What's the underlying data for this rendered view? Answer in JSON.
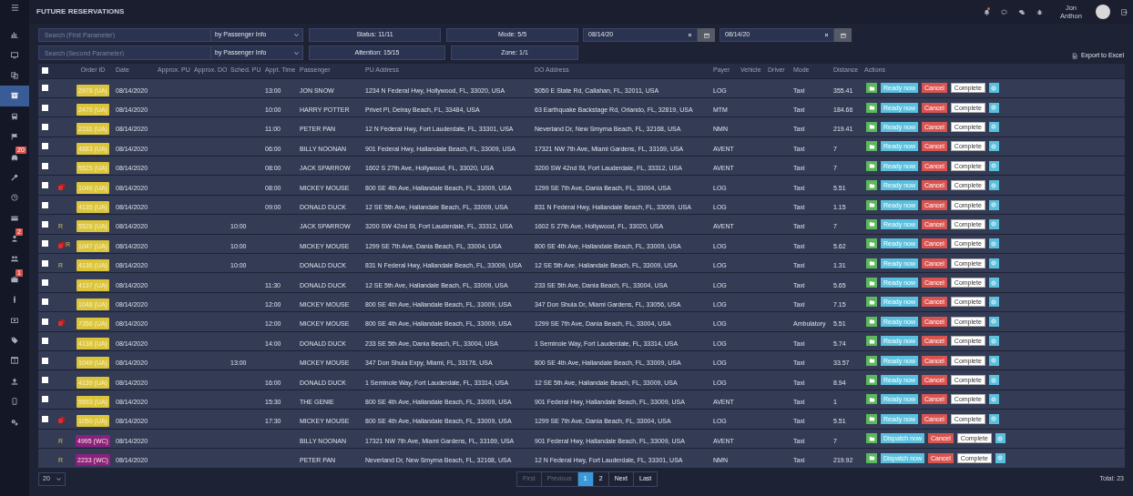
{
  "page_title": "FUTURE RESERVATIONS",
  "sidebar": {
    "items": [
      {
        "selected": false
      },
      {
        "selected": false
      },
      {
        "selected": false
      },
      {
        "selected": true
      },
      {
        "selected": false
      },
      {
        "selected": false
      },
      {
        "selected": false,
        "badge": "20"
      },
      {
        "selected": false
      },
      {
        "selected": false
      },
      {
        "selected": false
      },
      {
        "selected": false,
        "badge": "2"
      },
      {
        "selected": false
      },
      {
        "selected": false,
        "badge": "1"
      },
      {
        "selected": false
      },
      {
        "selected": false
      },
      {
        "selected": false
      },
      {
        "selected": false
      },
      {
        "selected": false
      },
      {
        "selected": false
      },
      {
        "selected": false
      }
    ]
  },
  "header": {
    "notification_dot": true,
    "user_name": "Jon Anthon"
  },
  "filters": {
    "search_1": {
      "placeholder": "Search (First Parameter)",
      "by": "by Passenger Info"
    },
    "search_2": {
      "placeholder": "Search (Second Parameter)",
      "by": "by Passenger Info"
    },
    "status": "Status: 11/11",
    "mode": "Mode: 5/5",
    "attention": "Attention: 15/15",
    "zone": "Zone: 1/1",
    "date_from": "08/14/20",
    "date_to": "08/14/20"
  },
  "export": "Export to Excel",
  "table": {
    "select_all": {
      "checked": false
    },
    "columns": [
      "Order ID",
      "Date",
      "Approx. PU",
      "Approx. DO",
      "Sched. PU",
      "Appt. Time",
      "Passenger",
      "PU Address",
      "DO Address",
      "Payer",
      "Vehicle",
      "Driver",
      "Mode",
      "Distance",
      "Actions"
    ],
    "rows": [
      {
        "checked": false,
        "flagged": false,
        "order": {
          "text": "2978 (UA)",
          "color": "#dcc53a"
        },
        "date": "08/14/2020",
        "sched_pu": "",
        "appt": "13:00",
        "passenger": "JON SNOW",
        "pu": "1234 N Federal Hwy, Hollywood, FL, 33020, USA",
        "do": "5050 E State Rd, Callahan, FL, 32011, USA",
        "payer": "LOG",
        "mode": "Taxi",
        "distance": "355.41",
        "dispatch": "Ready now",
        "cancel": "Cancel",
        "complete": "Complete"
      },
      {
        "checked": false,
        "flagged": false,
        "order": {
          "text": "2470 (UA)",
          "color": "#dcc53a"
        },
        "date": "08/14/2020",
        "appt": "10:00",
        "passenger": "HARRY POTTER",
        "pu": "Privet Pl, Delray Beach, FL, 33484, USA",
        "do": "63 Earthquake Backstage Rd, Orlando, FL, 32819, USA",
        "payer": "MTM",
        "mode": "Taxi",
        "distance": "184.66",
        "dispatch": "Ready now",
        "cancel": "Cancel",
        "complete": "Complete"
      },
      {
        "checked": false,
        "flagged": false,
        "order": {
          "text": "2231 (UA)",
          "color": "#dcc53a"
        },
        "date": "08/14/2020",
        "appt": "11:00",
        "passenger": "PETER PAN",
        "pu": "12 N Federal Hwy, Fort Lauderdale, FL, 33301, USA",
        "do": "Neverland Dr, New Smyrna Beach, FL, 32168, USA",
        "payer": "NMN",
        "mode": "Taxi",
        "distance": "219.41",
        "dispatch": "Ready now",
        "cancel": "Cancel",
        "complete": "Complete"
      },
      {
        "checked": false,
        "flagged": false,
        "order": {
          "text": "4883 (UA)",
          "color": "#dcc53a"
        },
        "date": "08/14/2020",
        "appt": "06:00",
        "passenger": "BILLY NOONAN",
        "pu": "901 Federal Hwy, Hallandale Beach, FL, 33009, USA",
        "do": "17321 NW 7th Ave, Miami Gardens, FL, 33169, USA",
        "payer": "AVENT",
        "mode": "Taxi",
        "distance": "7",
        "dispatch": "Ready now",
        "cancel": "Cancel",
        "complete": "Complete"
      },
      {
        "checked": false,
        "flagged": false,
        "order": {
          "text": "5525 (UA)",
          "color": "#dcc53a"
        },
        "date": "08/14/2020",
        "appt": "08:00",
        "passenger": "JACK SPARROW",
        "pu": "1602 S 27th Ave, Hollywood, FL, 33020, USA",
        "do": "3200 SW 42nd St, Fort Lauderdale, FL, 33312, USA",
        "payer": "AVENT",
        "mode": "Taxi",
        "distance": "7",
        "dispatch": "Ready now",
        "cancel": "Cancel",
        "complete": "Complete"
      },
      {
        "checked": false,
        "flagged": true,
        "order": {
          "text": "1046 (UA)",
          "color": "#dcc53a"
        },
        "date": "08/14/2020",
        "appt": "08:00",
        "passenger": "MICKEY MOUSE",
        "pu": "800 SE 4th Ave, Hallandale Beach, FL, 33009, USA",
        "do": "1299 SE 7th Ave, Dania Beach, FL, 33004, USA",
        "payer": "LOG",
        "mode": "Taxi",
        "distance": "5.51",
        "dispatch": "Ready now",
        "cancel": "Cancel",
        "complete": "Complete"
      },
      {
        "checked": false,
        "flagged": false,
        "order": {
          "text": "4135 (UA)",
          "color": "#dcc53a"
        },
        "date": "08/14/2020",
        "appt": "09:00",
        "passenger": "DONALD DUCK",
        "pu": "12 SE 5th Ave, Hallandale Beach, FL, 33009, USA",
        "do": "831 N Federal Hwy, Hallandale Beach, FL, 33009, USA",
        "payer": "LOG",
        "mode": "Taxi",
        "distance": "1.15",
        "dispatch": "Ready now",
        "cancel": "Cancel",
        "complete": "Complete"
      },
      {
        "checked": false,
        "flagged": false,
        "mark": "R",
        "order": {
          "text": "5526 (UA)",
          "color": "#dcc53a"
        },
        "date": "08/14/2020",
        "sched_pu": "10:00",
        "passenger": "JACK SPARROW",
        "pu": "3200 SW 42nd St, Fort Lauderdale, FL, 33312, USA",
        "do": "1602 S 27th Ave, Hollywood, FL, 33020, USA",
        "payer": "AVENT",
        "mode": "Taxi",
        "distance": "7",
        "dispatch": "Ready now",
        "cancel": "Cancel",
        "complete": "Complete"
      },
      {
        "checked": false,
        "flagged": true,
        "mark": "R",
        "order": {
          "text": "1047 (UA)",
          "color": "#dcc53a"
        },
        "date": "08/14/2020",
        "sched_pu": "10:00",
        "passenger": "MICKEY MOUSE",
        "pu": "1299 SE 7th Ave, Dania Beach, FL, 33004, USA",
        "do": "800 SE 4th Ave, Hallandale Beach, FL, 33009, USA",
        "payer": "LOG",
        "mode": "Taxi",
        "distance": "5.62",
        "dispatch": "Ready now",
        "cancel": "Cancel",
        "complete": "Complete"
      },
      {
        "checked": false,
        "flagged": false,
        "mark": "R",
        "order": {
          "text": "4136 (UA)",
          "color": "#dcc53a"
        },
        "date": "08/14/2020",
        "sched_pu": "10:00",
        "passenger": "DONALD DUCK",
        "pu": "831 N Federal Hwy, Hallandale Beach, FL, 33009, USA",
        "do": "12 SE 5th Ave, Hallandale Beach, FL, 33009, USA",
        "payer": "LOG",
        "mode": "Taxi",
        "distance": "1.31",
        "dispatch": "Ready now",
        "cancel": "Cancel",
        "complete": "Complete"
      },
      {
        "checked": false,
        "flagged": false,
        "order": {
          "text": "4137 (UA)",
          "color": "#dcc53a"
        },
        "date": "08/14/2020",
        "appt": "11:30",
        "passenger": "DONALD DUCK",
        "pu": "12 SE 5th Ave, Hallandale Beach, FL, 33009, USA",
        "do": "233 SE 5th Ave, Dania Beach, FL, 33004, USA",
        "payer": "LOG",
        "mode": "Taxi",
        "distance": "5.65",
        "dispatch": "Ready now",
        "cancel": "Cancel",
        "complete": "Complete"
      },
      {
        "checked": false,
        "flagged": false,
        "order": {
          "text": "1048 (UA)",
          "color": "#dcc53a"
        },
        "date": "08/14/2020",
        "appt": "12:00",
        "passenger": "MICKEY MOUSE",
        "pu": "800 SE 4th Ave, Hallandale Beach, FL, 33009, USA",
        "do": "347 Don Shula Dr, Miami Gardens, FL, 33056, USA",
        "payer": "LOG",
        "mode": "Taxi",
        "distance": "7.15",
        "dispatch": "Ready now",
        "cancel": "Cancel",
        "complete": "Complete"
      },
      {
        "checked": false,
        "flagged": true,
        "order": {
          "text": "7356 (UA)",
          "color": "#dcc53a"
        },
        "date": "08/14/2020",
        "appt": "12:00",
        "passenger": "MICKEY MOUSE",
        "pu": "800 SE 4th Ave, Hallandale Beach, FL, 33009, USA",
        "do": "1299 SE 7th Ave, Dania Beach, FL, 33004, USA",
        "payer": "LOG",
        "mode": "Ambulatory",
        "distance": "5.51",
        "dispatch": "Ready now",
        "cancel": "Cancel",
        "complete": "Complete"
      },
      {
        "checked": false,
        "flagged": false,
        "order": {
          "text": "4138 (UA)",
          "color": "#dcc53a"
        },
        "date": "08/14/2020",
        "appt": "14:00",
        "passenger": "DONALD DUCK",
        "pu": "233 SE 5th Ave, Dania Beach, FL, 33004, USA",
        "do": "1 Seminole Way, Fort Lauderdale, FL, 33314, USA",
        "payer": "LOG",
        "mode": "Taxi",
        "distance": "5.74",
        "dispatch": "Ready now",
        "cancel": "Cancel",
        "complete": "Complete"
      },
      {
        "checked": false,
        "flagged": false,
        "order": {
          "text": "1049 (UA)",
          "color": "#dcc53a"
        },
        "date": "08/14/2020",
        "sched_pu": "13:00",
        "passenger": "MICKEY MOUSE",
        "pu": "347 Don Shula Expy, Miami, FL, 33176, USA",
        "do": "800 SE 4th Ave, Hallandale Beach, FL, 33009, USA",
        "payer": "LOG",
        "mode": "Taxi",
        "distance": "33.57",
        "dispatch": "Ready now",
        "cancel": "Cancel",
        "complete": "Complete"
      },
      {
        "checked": false,
        "flagged": false,
        "order": {
          "text": "4139 (UA)",
          "color": "#dcc53a"
        },
        "date": "08/14/2020",
        "appt": "16:00",
        "passenger": "DONALD DUCK",
        "pu": "1 Seminole Way, Fort Lauderdale, FL, 33314, USA",
        "do": "12 SE 5th Ave, Hallandale Beach, FL, 33009, USA",
        "payer": "LOG",
        "mode": "Taxi",
        "distance": "8.94",
        "dispatch": "Ready now",
        "cancel": "Cancel",
        "complete": "Complete"
      },
      {
        "checked": false,
        "flagged": false,
        "order": {
          "text": "5593 (UA)",
          "color": "#dcc53a"
        },
        "date": "08/14/2020",
        "appt": "15:30",
        "passenger": "THE GENIE",
        "pu": "800 SE 4th Ave, Hallandale Beach, FL, 33009, USA",
        "do": "901 Federal Hwy, Hallandale Beach, FL, 33009, USA",
        "payer": "AVENT",
        "mode": "Taxi",
        "distance": "1",
        "dispatch": "Ready now",
        "cancel": "Cancel",
        "complete": "Complete"
      },
      {
        "checked": false,
        "flagged": true,
        "order": {
          "text": "1050 (UA)",
          "color": "#dcc53a"
        },
        "date": "08/14/2020",
        "appt": "17:30",
        "passenger": "MICKEY MOUSE",
        "pu": "800 SE 4th Ave, Hallandale Beach, FL, 33009, USA",
        "do": "1299 SE 7th Ave, Dania Beach, FL, 33004, USA",
        "payer": "LOG",
        "mode": "Taxi",
        "distance": "5.51",
        "dispatch": "Ready now",
        "cancel": "Cancel",
        "complete": "Complete"
      },
      {
        "flagged": false,
        "mark": "R",
        "order": {
          "text": "4995 (WC)",
          "color": "#8c1f80"
        },
        "date": "08/14/2020",
        "passenger": "BILLY NOONAN",
        "pu": "17321 NW 7th Ave, Miami Gardens, FL, 33169, USA",
        "do": "901 Federal Hwy, Hallandale Beach, FL, 33009, USA",
        "payer": "AVENT",
        "mode": "Taxi",
        "distance": "7",
        "dispatch": "Dispatch now",
        "cancel": "Cancel",
        "complete": "Complete"
      },
      {
        "flagged": false,
        "mark": "R",
        "order": {
          "text": "2233 (WC)",
          "color": "#8c1f80"
        },
        "date": "08/14/2020",
        "passenger": "PETER PAN",
        "pu": "Neverland Dr, New Smyrna Beach, FL, 32168, USA",
        "do": "12 N Federal Hwy, Fort Lauderdale, FL, 33301, USA",
        "payer": "NMN",
        "mode": "Taxi",
        "distance": "219.92",
        "dispatch": "Dispatch now",
        "cancel": "Cancel",
        "complete": "Complete"
      }
    ]
  },
  "page_size": "20",
  "pagination": [
    {
      "label": "First",
      "disabled": true,
      "selected": false
    },
    {
      "label": "Previous",
      "disabled": true,
      "selected": false
    },
    {
      "label": "1",
      "disabled": false,
      "selected": true
    },
    {
      "label": "2",
      "disabled": false,
      "selected": false
    },
    {
      "label": "Next",
      "disabled": false,
      "selected": false
    },
    {
      "label": "Last",
      "disabled": false,
      "selected": false
    }
  ],
  "total": "Total: 23"
}
